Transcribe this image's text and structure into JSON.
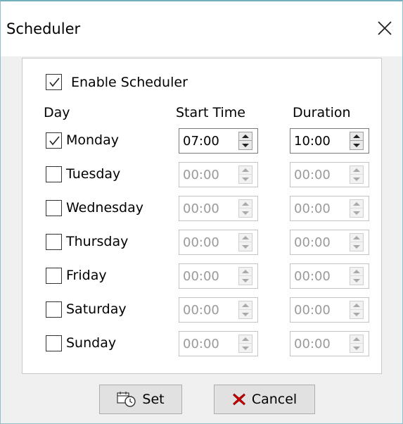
{
  "window": {
    "title": "Scheduler",
    "close_icon": "close-icon"
  },
  "enable": {
    "label": "Enable Scheduler",
    "checked": true
  },
  "headers": {
    "day": "Day",
    "start_time": "Start Time",
    "duration": "Duration"
  },
  "days": [
    {
      "label": "Monday",
      "checked": true,
      "start": "07:00",
      "duration": "10:00",
      "enabled": true
    },
    {
      "label": "Tuesday",
      "checked": false,
      "start": "00:00",
      "duration": "00:00",
      "enabled": false
    },
    {
      "label": "Wednesday",
      "checked": false,
      "start": "00:00",
      "duration": "00:00",
      "enabled": false
    },
    {
      "label": "Thursday",
      "checked": false,
      "start": "00:00",
      "duration": "00:00",
      "enabled": false
    },
    {
      "label": "Friday",
      "checked": false,
      "start": "00:00",
      "duration": "00:00",
      "enabled": false
    },
    {
      "label": "Saturday",
      "checked": false,
      "start": "00:00",
      "duration": "00:00",
      "enabled": false
    },
    {
      "label": "Sunday",
      "checked": false,
      "start": "00:00",
      "duration": "00:00",
      "enabled": false
    }
  ],
  "buttons": {
    "set": {
      "label": "Set",
      "icon": "schedule-clock-icon"
    },
    "cancel": {
      "label": "Cancel",
      "icon": "red-x-icon"
    }
  },
  "colors": {
    "cancel_icon": "#cc0000",
    "window_border": "#6fb0bb"
  }
}
